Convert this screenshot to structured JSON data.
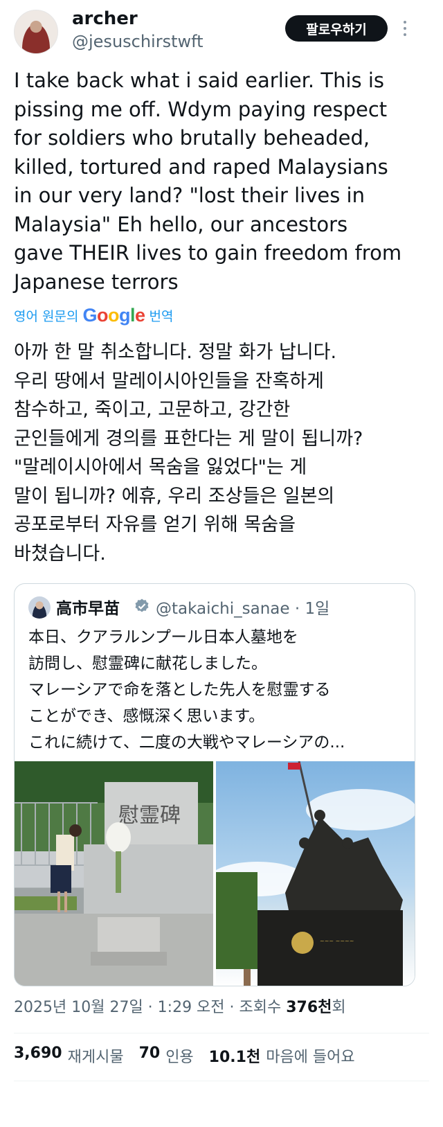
{
  "header": {
    "display_name": "archer",
    "handle": "@jesuschirstwft",
    "follow_label": "팔로우하기"
  },
  "tweet": {
    "text": "I take back what i said earlier. This is\npissing me off. Wdym paying respect\nfor soldiers who brutally beheaded,\nkilled, tortured and raped Malaysians\nin our very land? \"lost their lives in\nMalaysia\" Eh hello, our ancestors\ngave THEIR lives to gain freedom from\nJapanese terrors",
    "translate_prefix": "영어 원문의",
    "google_letters": [
      "G",
      "o",
      "o",
      "g",
      "l",
      "e"
    ],
    "translate_suffix": "번역",
    "translated_text": "아까 한 말 취소합니다. 정말 화가 납니다.\n우리 땅에서 말레이시아인들을 잔혹하게\n참수하고, 죽이고, 고문하고, 강간한\n군인들에게 경의를 표한다는 게 말이 됩니까?\n\"말레이시아에서 목숨을 잃었다\"는 게\n말이 됩니까? 에휴, 우리 조상들은 일본의\n공포로부터 자유를 얻기 위해 목숨을\n바쳤습니다."
  },
  "quote": {
    "name": "高市早苗",
    "handle_time": "@takaichi_sanae · 1일",
    "text": "本日、クアラルンプール日本人墓地を\n訪問し、慰霊碑に献花しました。\nマレーシアで命を落とした先人を慰霊する\nことができ、感慨深く思います。\nこれに続けて、二度の大戦やマレーシアの...",
    "memorial_characters": "慰霊碑"
  },
  "meta": {
    "datetime": "2025년 10월 27일 · 1:29 오전 · 조회수 ",
    "views_number": "376천",
    "views_suffix": "회"
  },
  "stats": {
    "reposts_count": "3,690",
    "reposts_label": "재게시물",
    "quotes_count": "70",
    "quotes_label": "인용",
    "likes_count": "10.1천",
    "likes_label": "마음에 들어요"
  },
  "colors": {
    "accent": "#1d9bf0",
    "text": "#0f1419",
    "secondary": "#536471",
    "verified": "#829aab"
  }
}
